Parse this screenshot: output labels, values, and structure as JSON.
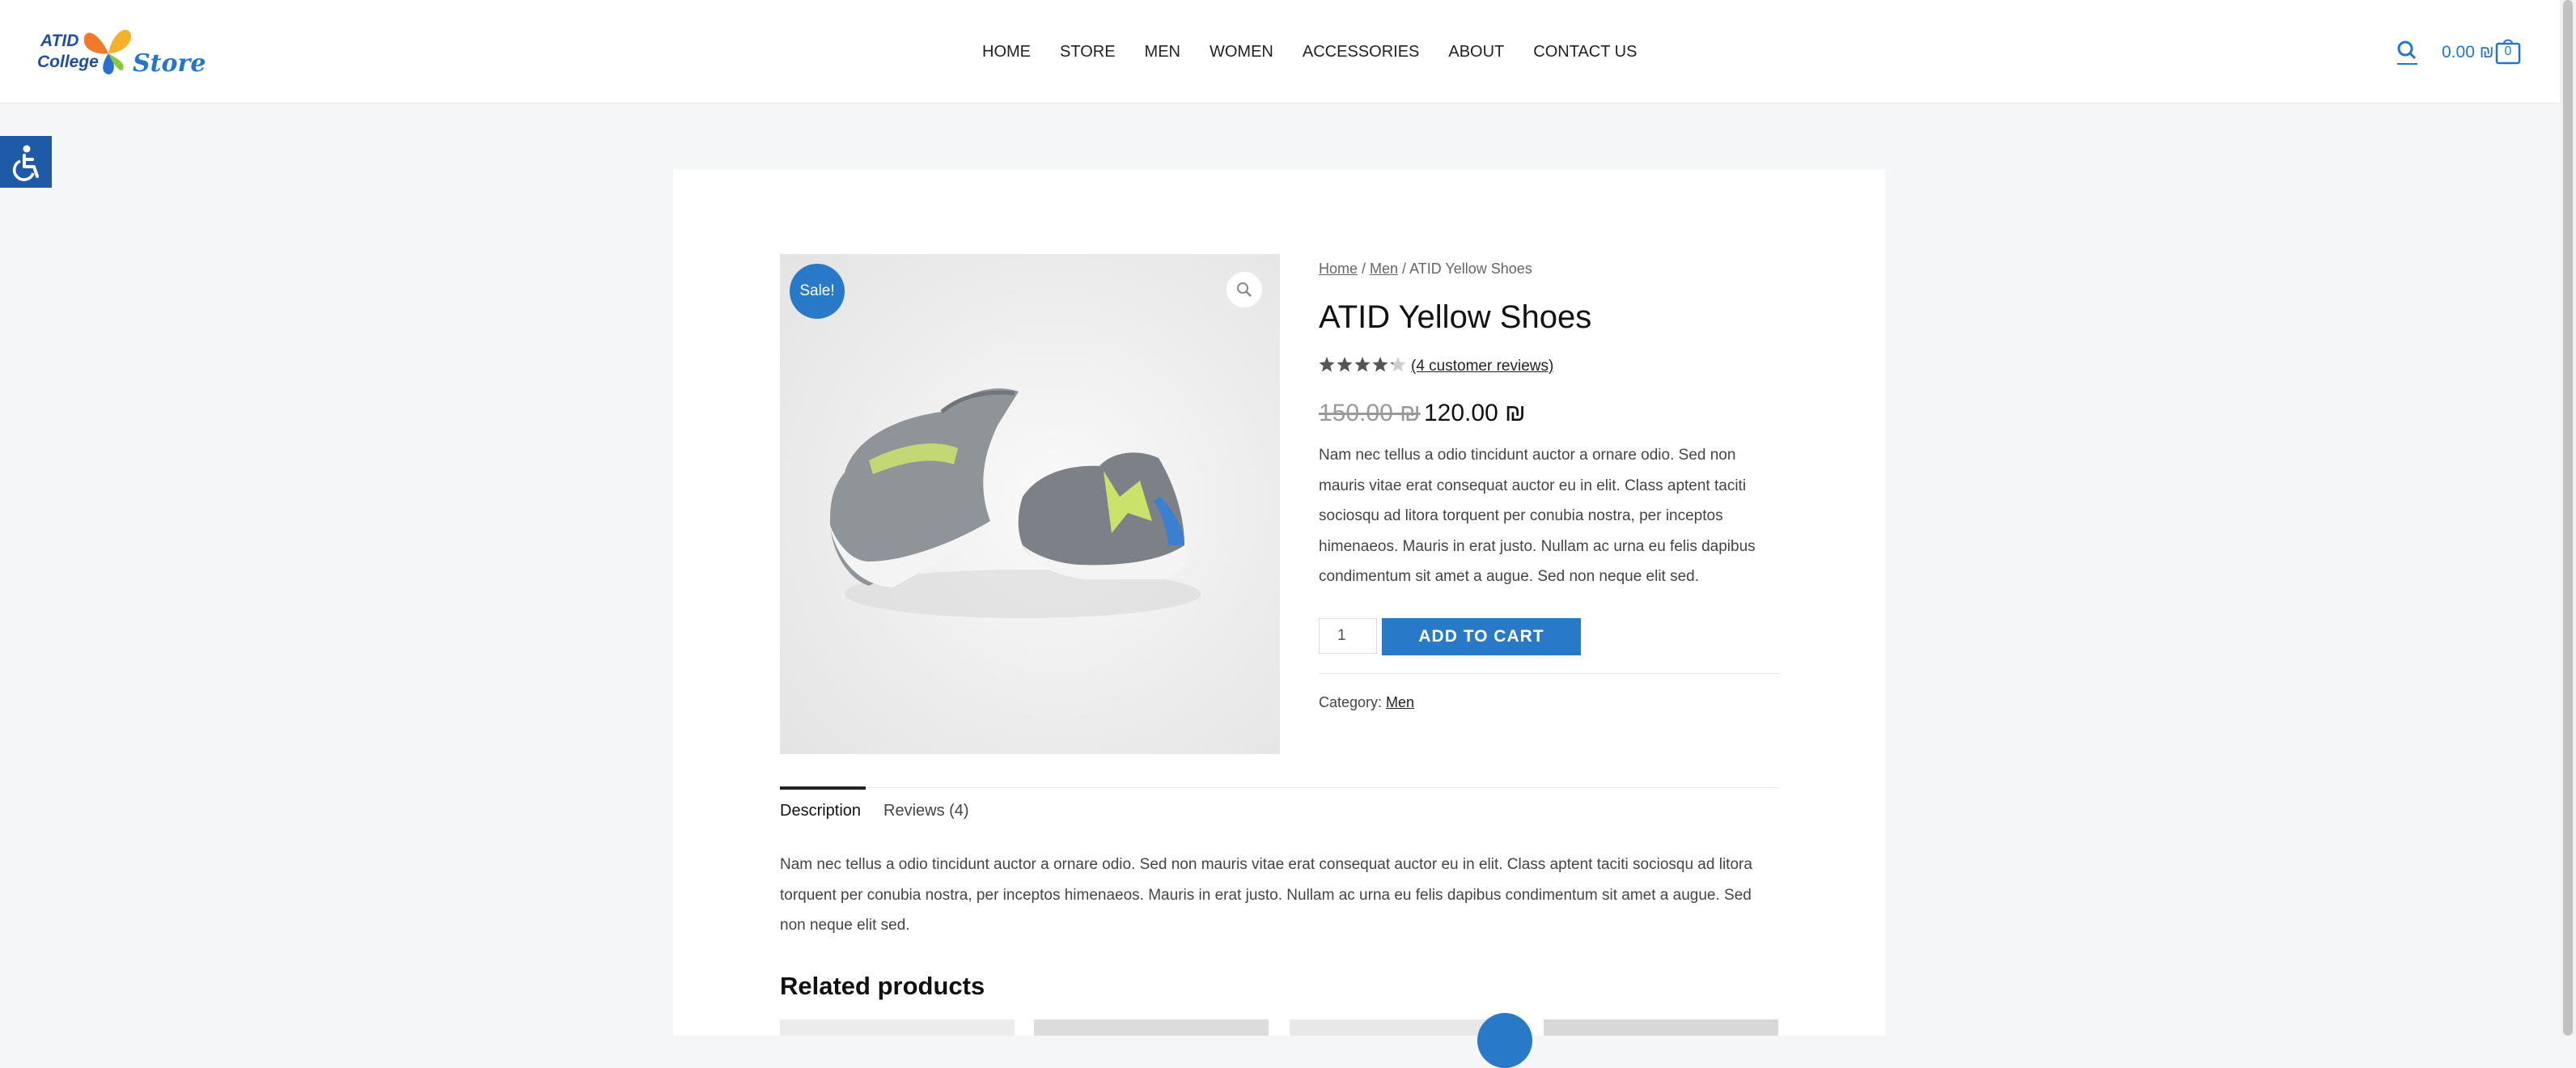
{
  "header": {
    "logo": {
      "line1": "ATID",
      "line2": "College",
      "store": "Store"
    },
    "nav": [
      "HOME",
      "STORE",
      "MEN",
      "WOMEN",
      "ACCESSORIES",
      "ABOUT",
      "CONTACT US"
    ],
    "cart_total": "0.00 ₪",
    "cart_count": "0"
  },
  "product": {
    "sale_badge": "Sale!",
    "breadcrumb": {
      "home": "Home",
      "sep1": " / ",
      "men": "Men",
      "sep2": " / ",
      "current": "ATID Yellow Shoes"
    },
    "title": "ATID Yellow Shoes",
    "rating_fraction": 0.85,
    "review_link": "(4 customer reviews)",
    "price_old": "150.00 ₪",
    "price_new": "120.00 ₪",
    "short_description": "Nam nec tellus a odio tincidunt auctor a ornare odio. Sed non mauris vitae erat consequat auctor eu in elit. Class aptent taciti sociosqu ad litora torquent per conubia nostra, per inceptos himenaeos. Mauris in erat justo. Nullam ac urna eu felis dapibus condimentum sit amet a augue. Sed non neque elit sed.",
    "quantity": "1",
    "add_to_cart_label": "ADD TO CART",
    "category_label": "Category: ",
    "category_value": "Men"
  },
  "tabs": {
    "description": "Description",
    "reviews": "Reviews (4)",
    "description_text": "Nam nec tellus a odio tincidunt auctor a ornare odio. Sed non mauris vitae erat consequat auctor eu in elit. Class aptent taciti sociosqu ad litora torquent per conubia nostra, per inceptos himenaeos. Mauris in erat justo. Nullam ac urna eu felis dapibus condimentum sit amet a augue. Sed non neque elit sed."
  },
  "related": {
    "title": "Related products"
  },
  "colors": {
    "accent": "#2879c8",
    "text": "#3a3a3a",
    "background": "#f4f6f8"
  },
  "icons": [
    "search-icon",
    "cart-icon",
    "accessibility-icon",
    "zoom-icon",
    "star-icon"
  ]
}
